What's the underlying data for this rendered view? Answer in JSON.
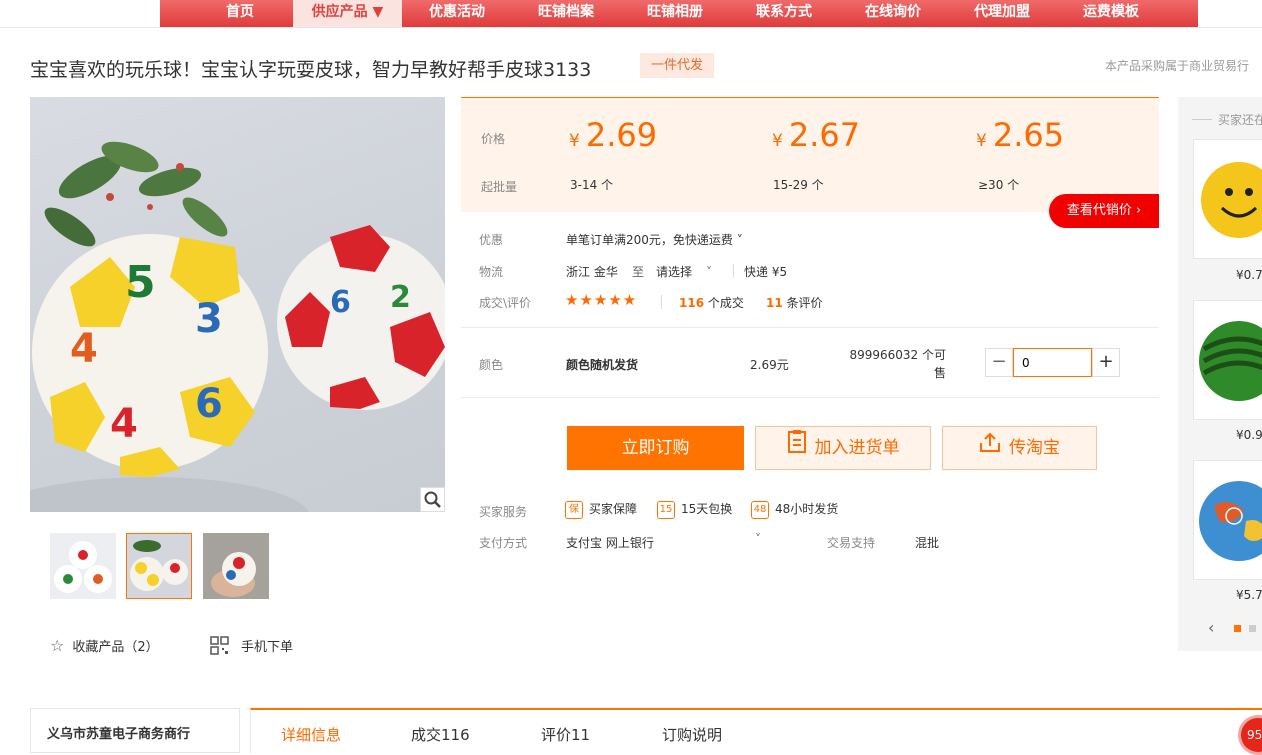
{
  "nav": {
    "items": [
      "首页",
      "供应产品 ▼",
      "优惠活动",
      "旺铺档案",
      "旺铺相册",
      "联系方式",
      "在线询价",
      "代理加盟",
      "运费模板"
    ],
    "active_index": 1
  },
  "product": {
    "title": "宝宝喜欢的玩乐球！宝宝认字玩耍皮球，智力早教好帮手皮球3133",
    "tag": "一件代发",
    "notice": "本产品采购属于商业贸易行"
  },
  "pricing": {
    "price_label": "价格",
    "qty_label": "起批量",
    "currency": "¥",
    "tiers": [
      {
        "price": "2.69",
        "qty": "3-14  个"
      },
      {
        "price": "2.67",
        "qty": "15-29  个"
      },
      {
        "price": "2.65",
        "qty": "≥30  个"
      }
    ],
    "agent_button": "查看代销价 ›"
  },
  "promo": {
    "label": "优惠",
    "text": "单笔订单满200元，免快递运费 ˅"
  },
  "logistics": {
    "label": "物流",
    "origin": "浙江  金华",
    "to": "至",
    "select": "请选择",
    "chevron": "˅",
    "shipping": "快递 ¥5"
  },
  "deals": {
    "label": "成交\\评价",
    "stars": "★★★★★",
    "deal_count": "116",
    "deal_unit": "个成交",
    "review_count": "11",
    "review_unit": "条评价"
  },
  "sku": {
    "label": "颜色",
    "name": "颜色随机发货",
    "price": "2.69元",
    "stock": "899966032 个可售",
    "quantity": "0",
    "minus": "−",
    "plus": "+"
  },
  "actions": {
    "order": "立即订购",
    "cart": "加入进货单",
    "taobao": "传淘宝"
  },
  "services": {
    "label": "买家服务",
    "items": [
      {
        "icon": "保",
        "text": "买家保障"
      },
      {
        "icon": "15",
        "text": "15天包换"
      },
      {
        "icon": "48",
        "text": "48小时发货"
      }
    ]
  },
  "payment": {
    "label": "支付方式",
    "methods": "支付宝   网上银行",
    "chevron": "˅",
    "trade_label": "交易支持",
    "trade_value": "混批"
  },
  "gallery": {
    "favorite": "收藏产品（2）",
    "mobile_order": "手机下单"
  },
  "right_column": {
    "title": "买家还在",
    "prices": [
      "¥0.7",
      "¥0.9",
      "¥5.7"
    ]
  },
  "shop": {
    "name": "义乌市苏童电子商务商行"
  },
  "tabs": [
    {
      "label": "详细信息"
    },
    {
      "label": "成交116"
    },
    {
      "label": "评价11"
    },
    {
      "label": "订购说明"
    }
  ],
  "float_badge": "95",
  "colors": {
    "accent": "#ff7300",
    "nav_red": "#e03b3b",
    "agent_red": "#f10000"
  }
}
